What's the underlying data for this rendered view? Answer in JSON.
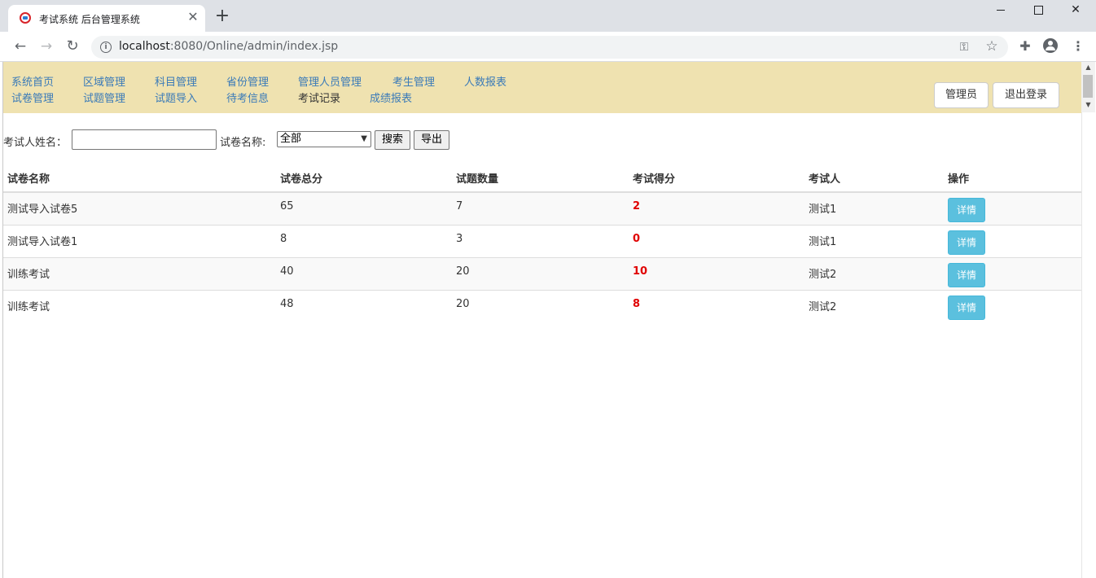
{
  "browser": {
    "tab_title": "考试系统 后台管理系统",
    "tab_close": "✕",
    "new_tab": "+",
    "url_host": "localhost",
    "url_path": ":8080/Online/admin/index.jsp",
    "icons": [
      "back-arrow-icon",
      "forward-arrow-icon",
      "reload-icon",
      "info-icon",
      "key-icon",
      "star-icon",
      "puzzle-icon",
      "profile-icon",
      "kebab-menu-icon"
    ]
  },
  "nav": {
    "row1": [
      "系统首页",
      "区域管理",
      "科目管理",
      "省份管理",
      "管理人员管理",
      "考生管理",
      "人数报表"
    ],
    "row2": [
      "试卷管理",
      "试题管理",
      "试题导入",
      "待考信息",
      "考试记录",
      "成绩报表"
    ],
    "current": "考试记录",
    "admin_label": "管理员",
    "logout_label": "退出登录",
    "link_color": "#3a7ab8",
    "bar_color": "#efe2b0"
  },
  "search": {
    "name_label": "考试人姓名：",
    "name_value": "",
    "paper_label": "试卷名称:",
    "paper_selected": "全部",
    "search_label": "搜索",
    "export_label": "导出"
  },
  "table": {
    "headers": [
      "试卷名称",
      "试卷总分",
      "试题数量",
      "考试得分",
      "考试人",
      "操作"
    ],
    "rows": [
      {
        "paper": "测试导入试卷5",
        "total": "65",
        "count": "7",
        "score": "2",
        "examinee": "测试1",
        "action": "详情"
      },
      {
        "paper": "测试导入试卷1",
        "total": "8",
        "count": "3",
        "score": "0",
        "examinee": "测试1",
        "action": "详情"
      },
      {
        "paper": "训练考试",
        "total": "40",
        "count": "20",
        "score": "10",
        "examinee": "测试2",
        "action": "详情"
      },
      {
        "paper": "训练考试",
        "total": "48",
        "count": "20",
        "score": "8",
        "examinee": "测试2",
        "action": "详情"
      }
    ],
    "score_color": "#e00000",
    "detail_button_color": "#5bc0de"
  }
}
